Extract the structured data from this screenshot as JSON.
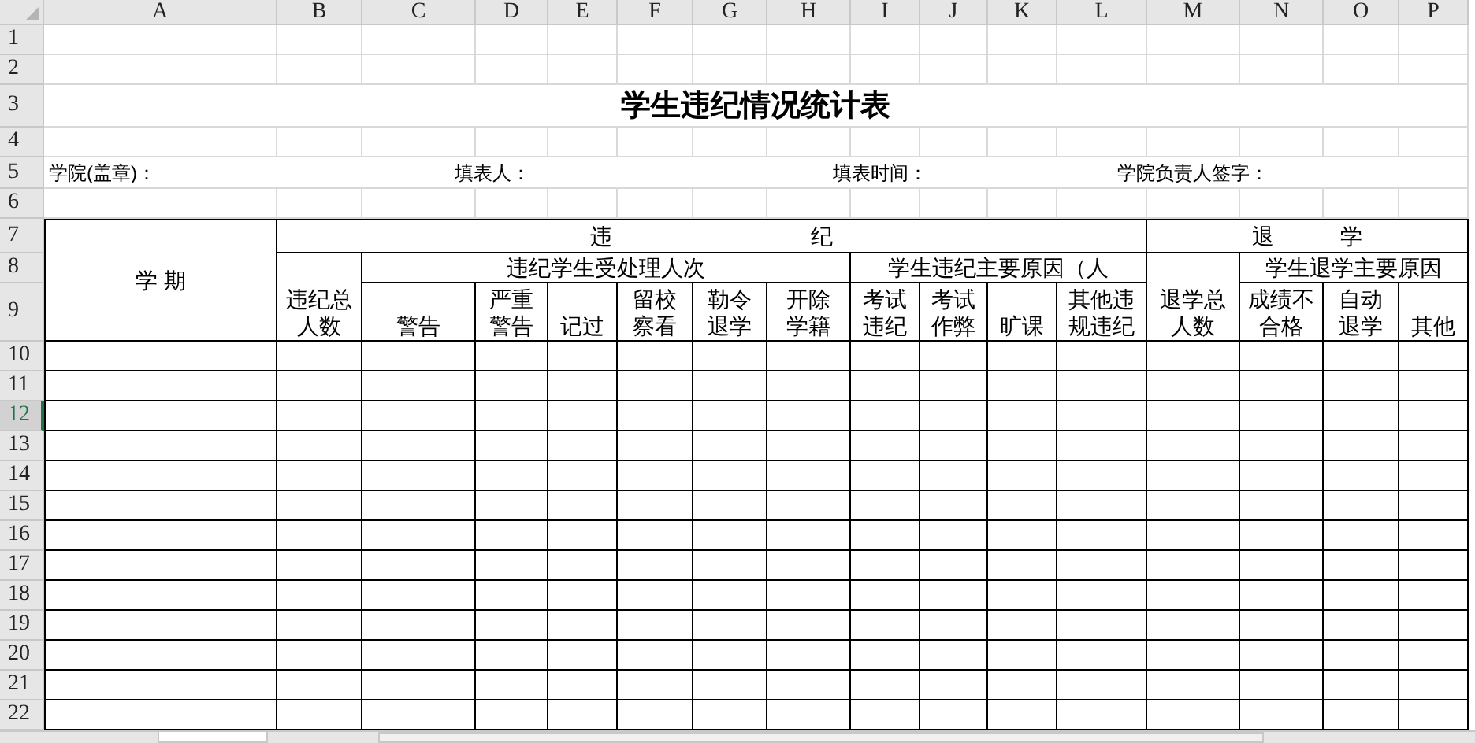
{
  "columns": [
    "A",
    "B",
    "C",
    "D",
    "E",
    "F",
    "G",
    "H",
    "I",
    "J",
    "K",
    "L",
    "M",
    "N",
    "O",
    "P"
  ],
  "rows": [
    {
      "label": "1",
      "selected": false
    },
    {
      "label": "2",
      "selected": false
    },
    {
      "label": "3",
      "selected": false
    },
    {
      "label": "4",
      "selected": false
    },
    {
      "label": "5",
      "selected": false
    },
    {
      "label": "6",
      "selected": false
    },
    {
      "label": "7",
      "selected": false
    },
    {
      "label": "8",
      "selected": false
    },
    {
      "label": "9",
      "selected": false
    },
    {
      "label": "10",
      "selected": false
    },
    {
      "label": "11",
      "selected": false
    },
    {
      "label": "12",
      "selected": true
    },
    {
      "label": "13",
      "selected": false
    },
    {
      "label": "14",
      "selected": false
    },
    {
      "label": "15",
      "selected": false
    },
    {
      "label": "16",
      "selected": false
    },
    {
      "label": "17",
      "selected": false
    },
    {
      "label": "18",
      "selected": false
    },
    {
      "label": "19",
      "selected": false
    },
    {
      "label": "20",
      "selected": false
    },
    {
      "label": "21",
      "selected": false
    },
    {
      "label": "22",
      "selected": false
    }
  ],
  "title": "学生违纪情况统计表",
  "form_labels": [
    "学院(盖章)：",
    "填表人：",
    "填表时间：",
    "学院负责人签字："
  ],
  "table_headers": [
    "学 期",
    "违　　　　　　　　　纪",
    "退　　　学",
    "违纪总人数",
    "违纪学生受处理人次",
    "学生违纪主要原因（人",
    "退学总人数",
    "学生退学主要原因",
    "警告",
    "严重警告",
    "记过",
    "留校察看",
    "勒令退学",
    "开除学籍",
    "考试违纪",
    "考试作弊",
    "旷课",
    "其他违规违纪",
    "成绩不合格",
    "自动退学",
    "其他"
  ]
}
